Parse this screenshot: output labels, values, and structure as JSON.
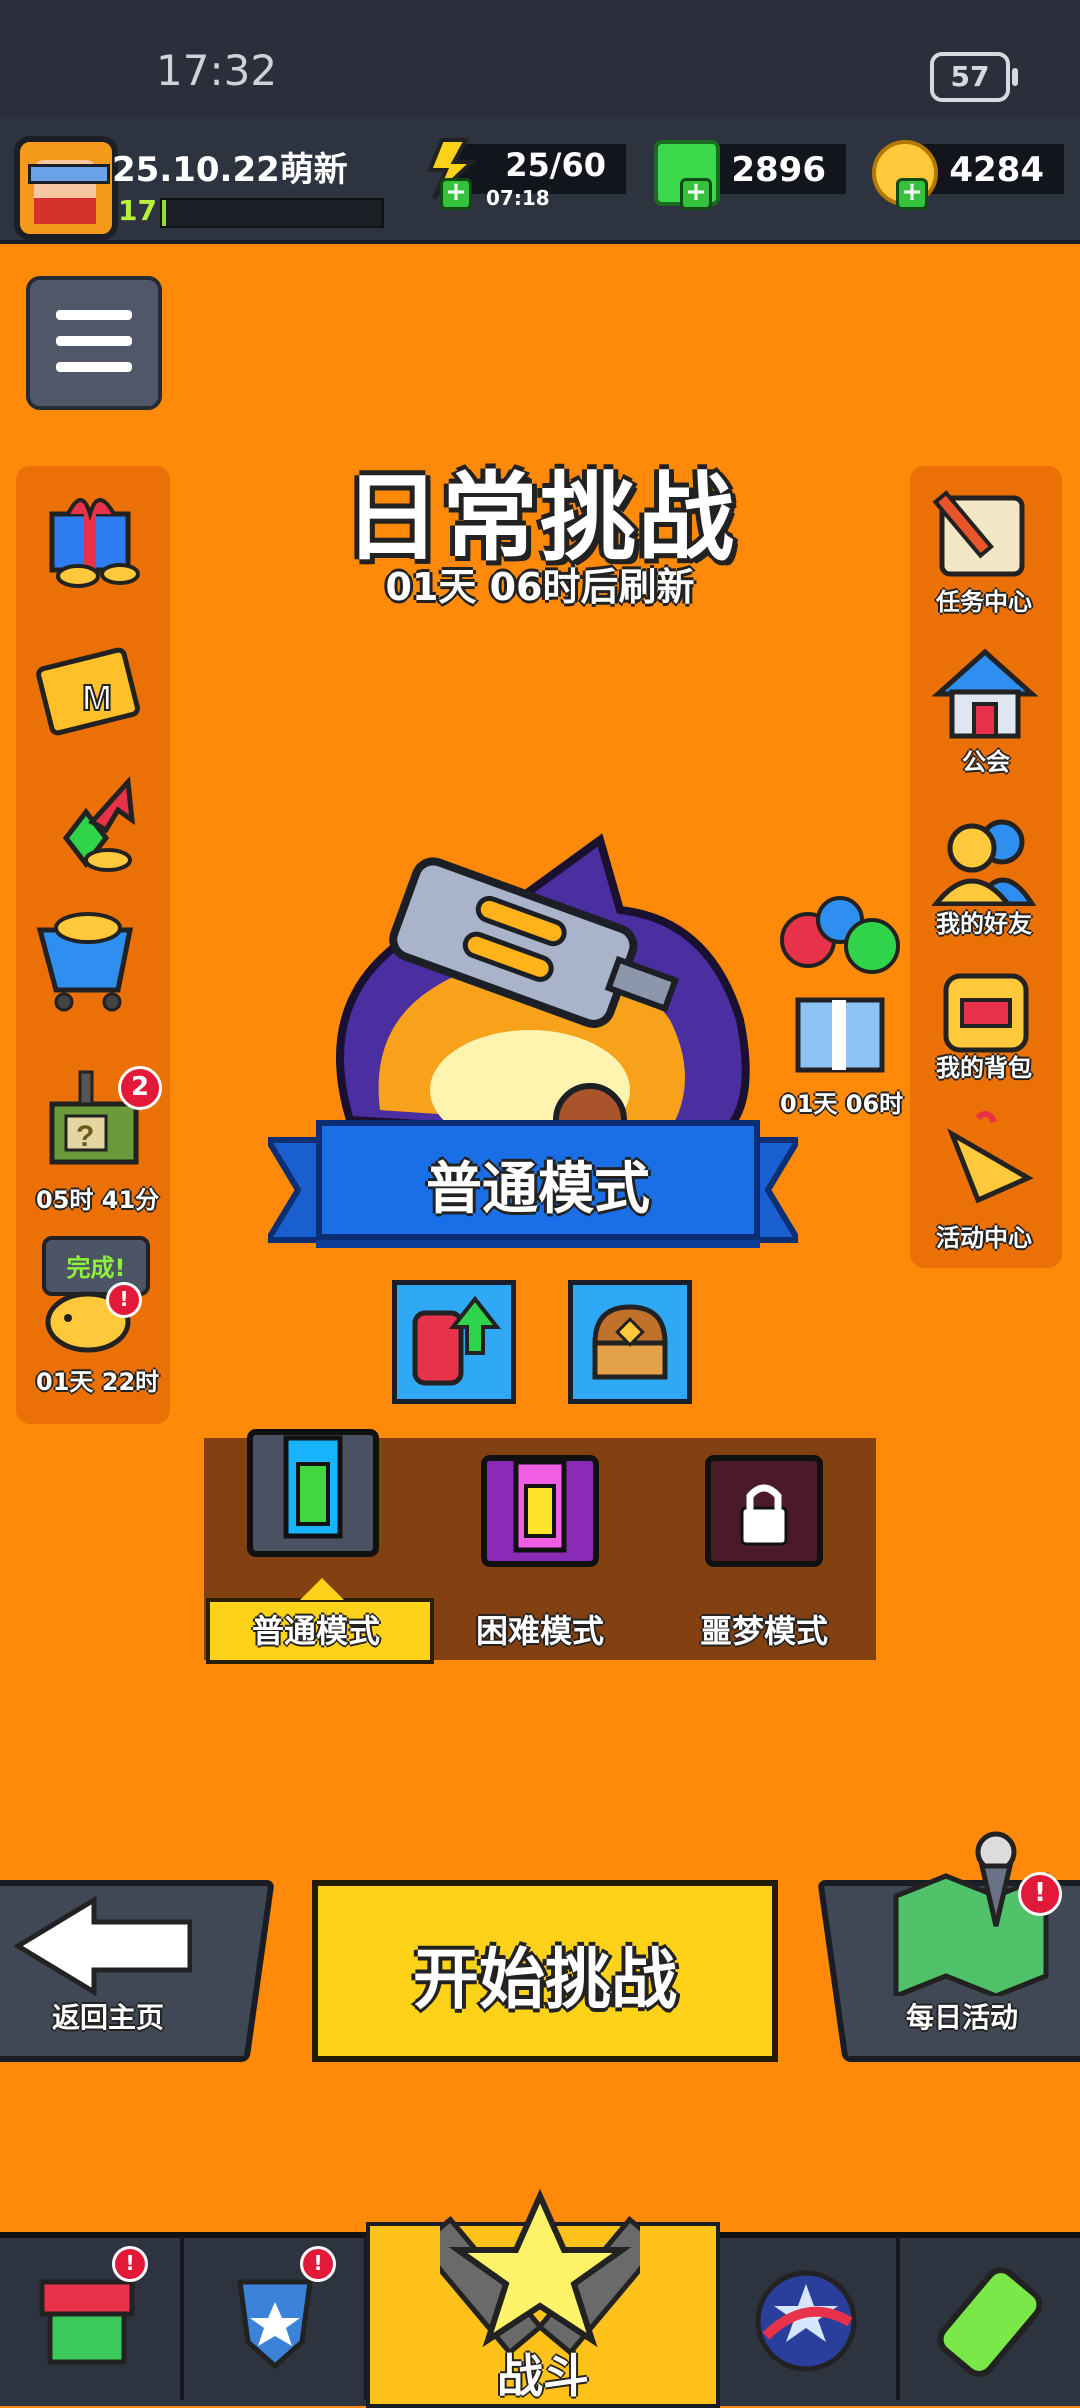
{
  "status_bar": {
    "time": "17:32",
    "battery": "57"
  },
  "player": {
    "name": "25.10.22萌新",
    "level": "17",
    "level_progress": 0.02
  },
  "resources": {
    "energy": {
      "value": "25/60",
      "timer": "07:18"
    },
    "gems": {
      "value": "2896"
    },
    "coins": {
      "value": "4284"
    }
  },
  "header": {
    "title": "日常挑战",
    "refresh": "01天 06时后刷新"
  },
  "left_sidebar": {
    "chest_timer": "05时 41分",
    "chest_badge": "2",
    "piggy_status": "完成!",
    "piggy_timer": "01天 22时"
  },
  "right_sidebar": {
    "items": [
      {
        "label": "任务中心"
      },
      {
        "label": "公会"
      },
      {
        "label": "我的好友"
      },
      {
        "label": "我的背包"
      },
      {
        "label": "活动中心"
      }
    ]
  },
  "gift_balloon": {
    "timer": "01天 06时"
  },
  "mode_banner": "普通模式",
  "difficulty_tabs": [
    {
      "label": "普通模式",
      "selected": true
    },
    {
      "label": "困难模式",
      "selected": false
    },
    {
      "label": "噩梦模式",
      "selected": false
    }
  ],
  "actions": {
    "back": "返回主页",
    "start": "开始挑战",
    "daily": "每日活动"
  },
  "bottom_nav": {
    "center": "战斗"
  },
  "colors": {
    "background": "#ff8a0a",
    "accent_yellow": "#ffd21a",
    "banner_blue": "#1a6fe6",
    "alert_red": "#e3193a"
  }
}
